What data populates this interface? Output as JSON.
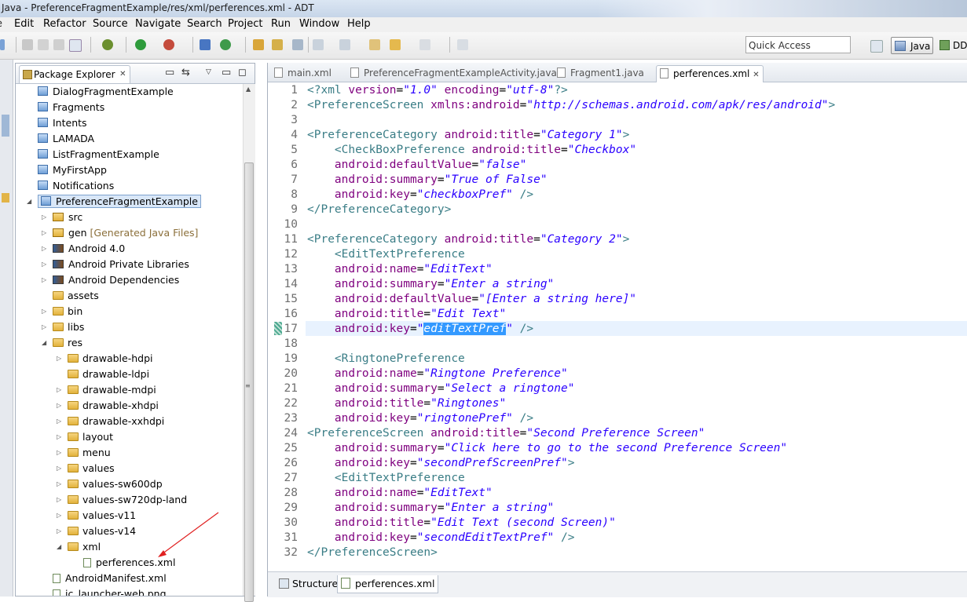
{
  "window": {
    "title": "Java - PreferenceFragmentExample/res/xml/perferences.xml - ADT"
  },
  "menu": [
    "Edit",
    "Refactor",
    "Source",
    "Navigate",
    "Search",
    "Project",
    "Run",
    "Window",
    "Help"
  ],
  "toolbar": {
    "quick_access": "Quick Access",
    "perspective_java": "Java",
    "perspective_ddms": "DD"
  },
  "package_explorer": {
    "title": "Package Explorer",
    "items": [
      {
        "label": "DialogFragmentExample"
      },
      {
        "label": "Fragments"
      },
      {
        "label": "Intents"
      },
      {
        "label": "LAMADA"
      },
      {
        "label": "ListFragmentExample"
      },
      {
        "label": "MyFirstApp"
      },
      {
        "label": "Notifications"
      },
      {
        "label": "PreferenceFragmentExample"
      },
      {
        "label": "src"
      },
      {
        "label": "gen",
        "decoration": "[Generated Java Files]"
      },
      {
        "label": "Android 4.0"
      },
      {
        "label": "Android Private Libraries"
      },
      {
        "label": "Android Dependencies"
      },
      {
        "label": "assets"
      },
      {
        "label": "bin"
      },
      {
        "label": "libs"
      },
      {
        "label": "res"
      },
      {
        "label": "drawable-hdpi"
      },
      {
        "label": "drawable-ldpi"
      },
      {
        "label": "drawable-mdpi"
      },
      {
        "label": "drawable-xhdpi"
      },
      {
        "label": "drawable-xxhdpi"
      },
      {
        "label": "layout"
      },
      {
        "label": "menu"
      },
      {
        "label": "values"
      },
      {
        "label": "values-sw600dp"
      },
      {
        "label": "values-sw720dp-land"
      },
      {
        "label": "values-v11"
      },
      {
        "label": "values-v14"
      },
      {
        "label": "xml"
      },
      {
        "label": "perferences.xml"
      },
      {
        "label": "AndroidManifest.xml"
      },
      {
        "label": "ic_launcher-web.png"
      }
    ]
  },
  "editor": {
    "tabs": [
      "main.xml",
      "PreferenceFragmentExampleActivity.java",
      "Fragment1.java",
      "perferences.xml"
    ],
    "active_tab": "perferences.xml",
    "line_numbers": [
      "1",
      "2",
      "3",
      "4",
      "5",
      "6",
      "7",
      "8",
      "9",
      "10",
      "11",
      "12",
      "13",
      "14",
      "15",
      "16",
      "17",
      "18",
      "19",
      "20",
      "21",
      "22",
      "23",
      "24",
      "25",
      "26",
      "27",
      "28",
      "29",
      "30",
      "31",
      "32"
    ],
    "bottom_tabs": [
      "Structure",
      "perferences.xml"
    ]
  },
  "colors": {
    "tag": "#3a7d86",
    "attribute": "#7f007f",
    "value": "#2a00ff",
    "selection": "#3399ff",
    "current_line": "#e8f2fe"
  }
}
